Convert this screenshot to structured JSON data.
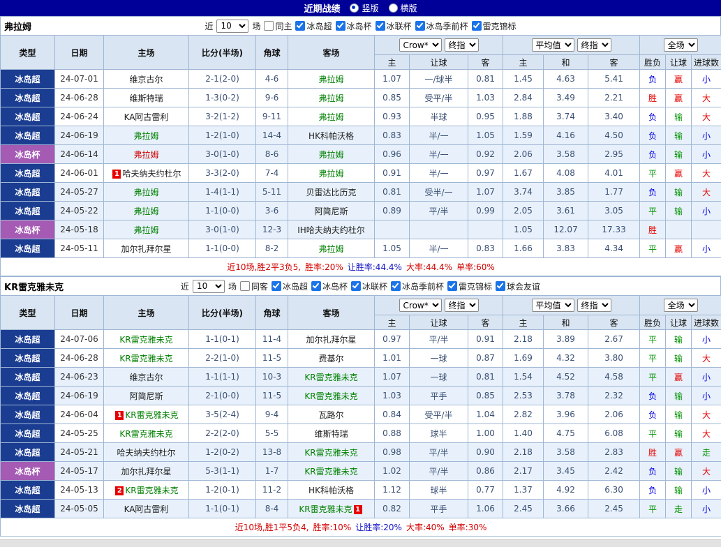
{
  "topbar": {
    "title": "近期战绩",
    "radios": [
      {
        "label": "竖版",
        "checked": true
      },
      {
        "label": "横版",
        "checked": false
      }
    ]
  },
  "filter_labels": {
    "near": "近",
    "count": "10",
    "games": "场"
  },
  "table_header": {
    "cols": [
      "类型",
      "日期",
      "主场",
      "比分(半场)",
      "角球",
      "客场"
    ],
    "sub": [
      "主",
      "让球",
      "客",
      "主",
      "和",
      "客",
      "胜负",
      "让球",
      "进球数"
    ],
    "selects": {
      "bookmaker": "Crow*",
      "final_asian": "终指",
      "average": "平均值",
      "final_euro": "终指",
      "scope": "全场"
    }
  },
  "colors": {
    "comp": {
      "冰岛超": "#1b3d91",
      "冰岛杯": "#a55ab4"
    },
    "team": {
      "green": "#008000",
      "black": "#222222",
      "red": "#d00000"
    },
    "result": {
      "胜": "#e60000",
      "平": "#009000",
      "负": "#0000e6",
      "赢": "#e60000",
      "输": "#009000",
      "走": "#009000",
      "大": "#e60000",
      "小": "#0000e6"
    },
    "text": {
      "red": "#d30000",
      "blue": "#1414c8",
      "black": "#222222"
    }
  },
  "sections": [
    {
      "team": "弗拉姆",
      "filter": {
        "same_venue": {
          "label": "同主",
          "checked": false
        },
        "competitions": [
          {
            "label": "冰岛超",
            "checked": true
          },
          {
            "label": "冰岛杯",
            "checked": true
          },
          {
            "label": "冰联杯",
            "checked": true
          },
          {
            "label": "冰岛季前杯",
            "checked": true
          },
          {
            "label": "雷克锦标",
            "checked": true
          }
        ]
      },
      "rows": [
        {
          "comp": "冰岛超",
          "date": "24-07-01",
          "home": {
            "name": "维京古尔",
            "color": "black"
          },
          "score": "2-1(2-0)",
          "corners": "4-6",
          "away": {
            "name": "弗拉姆",
            "color": "green"
          },
          "ah": [
            "1.07",
            "一/球半",
            "0.81"
          ],
          "eu": [
            "1.45",
            "4.63",
            "5.41"
          ],
          "res": [
            "负",
            "赢",
            "小"
          ],
          "hl": false
        },
        {
          "comp": "冰岛超",
          "date": "24-06-28",
          "home": {
            "name": "维斯特瑞",
            "color": "black"
          },
          "score": "1-3(0-2)",
          "corners": "9-6",
          "away": {
            "name": "弗拉姆",
            "color": "green"
          },
          "ah": [
            "0.85",
            "受平/半",
            "1.03"
          ],
          "eu": [
            "2.84",
            "3.49",
            "2.21"
          ],
          "res": [
            "胜",
            "赢",
            "大"
          ],
          "hl": false
        },
        {
          "comp": "冰岛超",
          "date": "24-06-24",
          "home": {
            "name": "KA阿古雷利",
            "color": "black"
          },
          "score": "3-2(1-2)",
          "corners": "9-11",
          "away": {
            "name": "弗拉姆",
            "color": "green"
          },
          "ah": [
            "0.93",
            "半球",
            "0.95"
          ],
          "eu": [
            "1.88",
            "3.74",
            "3.40"
          ],
          "res": [
            "负",
            "输",
            "大"
          ],
          "hl": false
        },
        {
          "comp": "冰岛超",
          "date": "24-06-19",
          "home": {
            "name": "弗拉姆",
            "color": "green"
          },
          "score": "1-2(1-0)",
          "corners": "14-4",
          "away": {
            "name": "HK科帕沃格",
            "color": "black"
          },
          "ah": [
            "0.83",
            "半/一",
            "1.05"
          ],
          "eu": [
            "1.59",
            "4.16",
            "4.50"
          ],
          "res": [
            "负",
            "输",
            "小"
          ],
          "hl": true
        },
        {
          "comp": "冰岛杯",
          "date": "24-06-14",
          "home": {
            "name": "弗拉姆",
            "color": "red"
          },
          "score": "3-0(1-0)",
          "corners": "8-6",
          "away": {
            "name": "弗拉姆",
            "color": "green"
          },
          "ah": [
            "0.96",
            "半/一",
            "0.92"
          ],
          "eu": [
            "2.06",
            "3.58",
            "2.95"
          ],
          "res": [
            "负",
            "输",
            "小"
          ],
          "hl": true
        },
        {
          "comp": "冰岛超",
          "date": "24-06-01",
          "home": {
            "name": "哈夫纳夫约杜尔",
            "color": "black",
            "card": {
              "num": "1",
              "pos": "before"
            }
          },
          "score": "3-3(2-0)",
          "corners": "7-4",
          "away": {
            "name": "弗拉姆",
            "color": "green"
          },
          "ah": [
            "0.91",
            "半/一",
            "0.97"
          ],
          "eu": [
            "1.67",
            "4.08",
            "4.01"
          ],
          "res": [
            "平",
            "赢",
            "大"
          ],
          "hl": false
        },
        {
          "comp": "冰岛超",
          "date": "24-05-27",
          "home": {
            "name": "弗拉姆",
            "color": "green"
          },
          "score": "1-4(1-1)",
          "corners": "5-11",
          "away": {
            "name": "贝雷达比历克",
            "color": "black"
          },
          "ah": [
            "0.81",
            "受半/一",
            "1.07"
          ],
          "eu": [
            "3.74",
            "3.85",
            "1.77"
          ],
          "res": [
            "负",
            "输",
            "大"
          ],
          "hl": true
        },
        {
          "comp": "冰岛超",
          "date": "24-05-22",
          "home": {
            "name": "弗拉姆",
            "color": "green"
          },
          "score": "1-1(0-0)",
          "corners": "3-6",
          "away": {
            "name": "阿简尼斯",
            "color": "black"
          },
          "ah": [
            "0.89",
            "平/半",
            "0.99"
          ],
          "eu": [
            "2.05",
            "3.61",
            "3.05"
          ],
          "res": [
            "平",
            "输",
            "小"
          ],
          "hl": true
        },
        {
          "comp": "冰岛杯",
          "date": "24-05-18",
          "home": {
            "name": "弗拉姆",
            "color": "green"
          },
          "score": "3-0(1-0)",
          "corners": "12-3",
          "away": {
            "name": "IH哈夫纳夫约杜尔",
            "color": "black"
          },
          "ah": [
            "",
            "",
            ""
          ],
          "eu": [
            "1.05",
            "12.07",
            "17.33"
          ],
          "res": [
            "胜",
            "",
            ""
          ],
          "hl": true
        },
        {
          "comp": "冰岛超",
          "date": "24-05-11",
          "home": {
            "name": "加尔扎拜尔星",
            "color": "black"
          },
          "score": "1-1(0-0)",
          "corners": "8-2",
          "away": {
            "name": "弗拉姆",
            "color": "green"
          },
          "ah": [
            "1.05",
            "半/一",
            "0.83"
          ],
          "eu": [
            "1.66",
            "3.83",
            "4.34"
          ],
          "res": [
            "平",
            "赢",
            "小"
          ],
          "hl": false
        }
      ],
      "summary": [
        {
          "text": "近10场,胜2平3负5,",
          "color": "red"
        },
        {
          "text": "胜率:20%",
          "color": "red"
        },
        {
          "text": "让胜率:44.4%",
          "color": "blue"
        },
        {
          "text": "大率:44.4%",
          "color": "red"
        },
        {
          "text": "单率:60%",
          "color": "red"
        }
      ]
    },
    {
      "team": "KR雷克雅未克",
      "filter": {
        "same_venue": {
          "label": "同客",
          "checked": false
        },
        "competitions": [
          {
            "label": "冰岛超",
            "checked": true
          },
          {
            "label": "冰岛杯",
            "checked": true
          },
          {
            "label": "冰联杯",
            "checked": true
          },
          {
            "label": "冰岛季前杯",
            "checked": true
          },
          {
            "label": "雷克锦标",
            "checked": true
          },
          {
            "label": "球会友谊",
            "checked": true
          }
        ]
      },
      "rows": [
        {
          "comp": "冰岛超",
          "date": "24-07-06",
          "home": {
            "name": "KR雷克雅未克",
            "color": "green"
          },
          "score": "1-1(0-1)",
          "corners": "11-4",
          "away": {
            "name": "加尔扎拜尔星",
            "color": "black"
          },
          "ah": [
            "0.97",
            "平/半",
            "0.91"
          ],
          "eu": [
            "2.18",
            "3.89",
            "2.67"
          ],
          "res": [
            "平",
            "输",
            "小"
          ],
          "hl": false
        },
        {
          "comp": "冰岛超",
          "date": "24-06-28",
          "home": {
            "name": "KR雷克雅未克",
            "color": "green"
          },
          "score": "2-2(1-0)",
          "corners": "11-5",
          "away": {
            "name": "费基尔",
            "color": "black"
          },
          "ah": [
            "1.01",
            "一球",
            "0.87"
          ],
          "eu": [
            "1.69",
            "4.32",
            "3.80"
          ],
          "res": [
            "平",
            "输",
            "大"
          ],
          "hl": false
        },
        {
          "comp": "冰岛超",
          "date": "24-06-23",
          "home": {
            "name": "维京古尔",
            "color": "black"
          },
          "score": "1-1(1-1)",
          "corners": "10-3",
          "away": {
            "name": "KR雷克雅未克",
            "color": "green"
          },
          "ah": [
            "1.07",
            "一球",
            "0.81"
          ],
          "eu": [
            "1.54",
            "4.52",
            "4.58"
          ],
          "res": [
            "平",
            "赢",
            "小"
          ],
          "hl": true
        },
        {
          "comp": "冰岛超",
          "date": "24-06-19",
          "home": {
            "name": "阿简尼斯",
            "color": "black"
          },
          "score": "2-1(0-0)",
          "corners": "11-5",
          "away": {
            "name": "KR雷克雅未克",
            "color": "green"
          },
          "ah": [
            "1.03",
            "平手",
            "0.85"
          ],
          "eu": [
            "2.53",
            "3.78",
            "2.32"
          ],
          "res": [
            "负",
            "输",
            "小"
          ],
          "hl": true
        },
        {
          "comp": "冰岛超",
          "date": "24-06-04",
          "home": {
            "name": "KR雷克雅未克",
            "color": "green",
            "card": {
              "num": "1",
              "pos": "before"
            }
          },
          "score": "3-5(2-4)",
          "corners": "9-4",
          "away": {
            "name": "瓦路尔",
            "color": "black"
          },
          "ah": [
            "0.84",
            "受平/半",
            "1.04"
          ],
          "eu": [
            "2.82",
            "3.96",
            "2.06"
          ],
          "res": [
            "负",
            "输",
            "大"
          ],
          "hl": false
        },
        {
          "comp": "冰岛超",
          "date": "24-05-25",
          "home": {
            "name": "KR雷克雅未克",
            "color": "green"
          },
          "score": "2-2(2-0)",
          "corners": "5-5",
          "away": {
            "name": "维斯特瑞",
            "color": "black"
          },
          "ah": [
            "0.88",
            "球半",
            "1.00"
          ],
          "eu": [
            "1.40",
            "4.75",
            "6.08"
          ],
          "res": [
            "平",
            "输",
            "大"
          ],
          "hl": false
        },
        {
          "comp": "冰岛超",
          "date": "24-05-21",
          "home": {
            "name": "哈夫纳夫约杜尔",
            "color": "black"
          },
          "score": "1-2(0-2)",
          "corners": "13-8",
          "away": {
            "name": "KR雷克雅未克",
            "color": "green"
          },
          "ah": [
            "0.98",
            "平/半",
            "0.90"
          ],
          "eu": [
            "2.18",
            "3.58",
            "2.83"
          ],
          "res": [
            "胜",
            "赢",
            "走"
          ],
          "hl": true
        },
        {
          "comp": "冰岛杯",
          "date": "24-05-17",
          "home": {
            "name": "加尔扎拜尔星",
            "color": "black"
          },
          "score": "5-3(1-1)",
          "corners": "1-7",
          "away": {
            "name": "KR雷克雅未克",
            "color": "green"
          },
          "ah": [
            "1.02",
            "平/半",
            "0.86"
          ],
          "eu": [
            "2.17",
            "3.45",
            "2.42"
          ],
          "res": [
            "负",
            "输",
            "大"
          ],
          "hl": true
        },
        {
          "comp": "冰岛超",
          "date": "24-05-13",
          "home": {
            "name": "KR雷克雅未克",
            "color": "green",
            "card": {
              "num": "2",
              "pos": "before"
            }
          },
          "score": "1-2(0-1)",
          "corners": "11-2",
          "away": {
            "name": "HK科帕沃格",
            "color": "black"
          },
          "ah": [
            "1.12",
            "球半",
            "0.77"
          ],
          "eu": [
            "1.37",
            "4.92",
            "6.30"
          ],
          "res": [
            "负",
            "输",
            "小"
          ],
          "hl": false
        },
        {
          "comp": "冰岛超",
          "date": "24-05-05",
          "home": {
            "name": "KA阿古雷利",
            "color": "black"
          },
          "score": "1-1(0-1)",
          "corners": "8-4",
          "away": {
            "name": "KR雷克雅未克",
            "color": "green",
            "card": {
              "num": "1",
              "pos": "after"
            }
          },
          "ah": [
            "0.82",
            "平手",
            "1.06"
          ],
          "eu": [
            "2.45",
            "3.66",
            "2.45"
          ],
          "res": [
            "平",
            "走",
            "小"
          ],
          "hl": true
        }
      ],
      "summary": [
        {
          "text": "近10场,胜1平5负4,",
          "color": "red"
        },
        {
          "text": "胜率:10%",
          "color": "red"
        },
        {
          "text": "让胜率:20%",
          "color": "blue"
        },
        {
          "text": "大率:40%",
          "color": "red"
        },
        {
          "text": "单率:30%",
          "color": "red"
        }
      ]
    }
  ]
}
